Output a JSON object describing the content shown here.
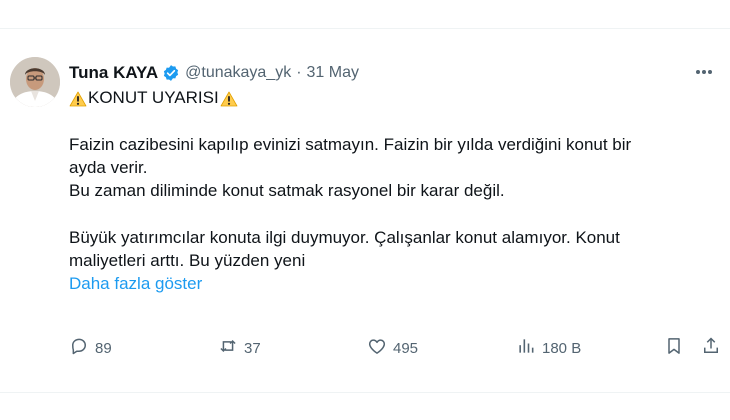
{
  "tweet": {
    "author_name": "Tuna KAYA",
    "handle": "@tunakaya_yk",
    "separator": "·",
    "date": "31 May",
    "title": "KONUT UYARISI",
    "lines": [
      "Faizin cazibesini kapılıp evinizi satmayın. Faizin bir yılda verdiğini konut bir",
      "ayda verir.",
      "Bu zaman diliminde konut satmak rasyonel bir karar değil.",
      "Büyük yatırımcılar konuta ilgi duymuyor. Çalışanlar konut alamıyor. Konut",
      "maliyetleri arttı. Bu yüzden yeni"
    ],
    "show_more": "Daha fazla göster"
  },
  "actions": {
    "replies": "89",
    "reposts": "37",
    "likes": "495",
    "views": "180 B"
  },
  "colors": {
    "text": "#0f1419",
    "secondary": "#536471",
    "link": "#1d9bf0",
    "verified": "#1d9bf0"
  }
}
